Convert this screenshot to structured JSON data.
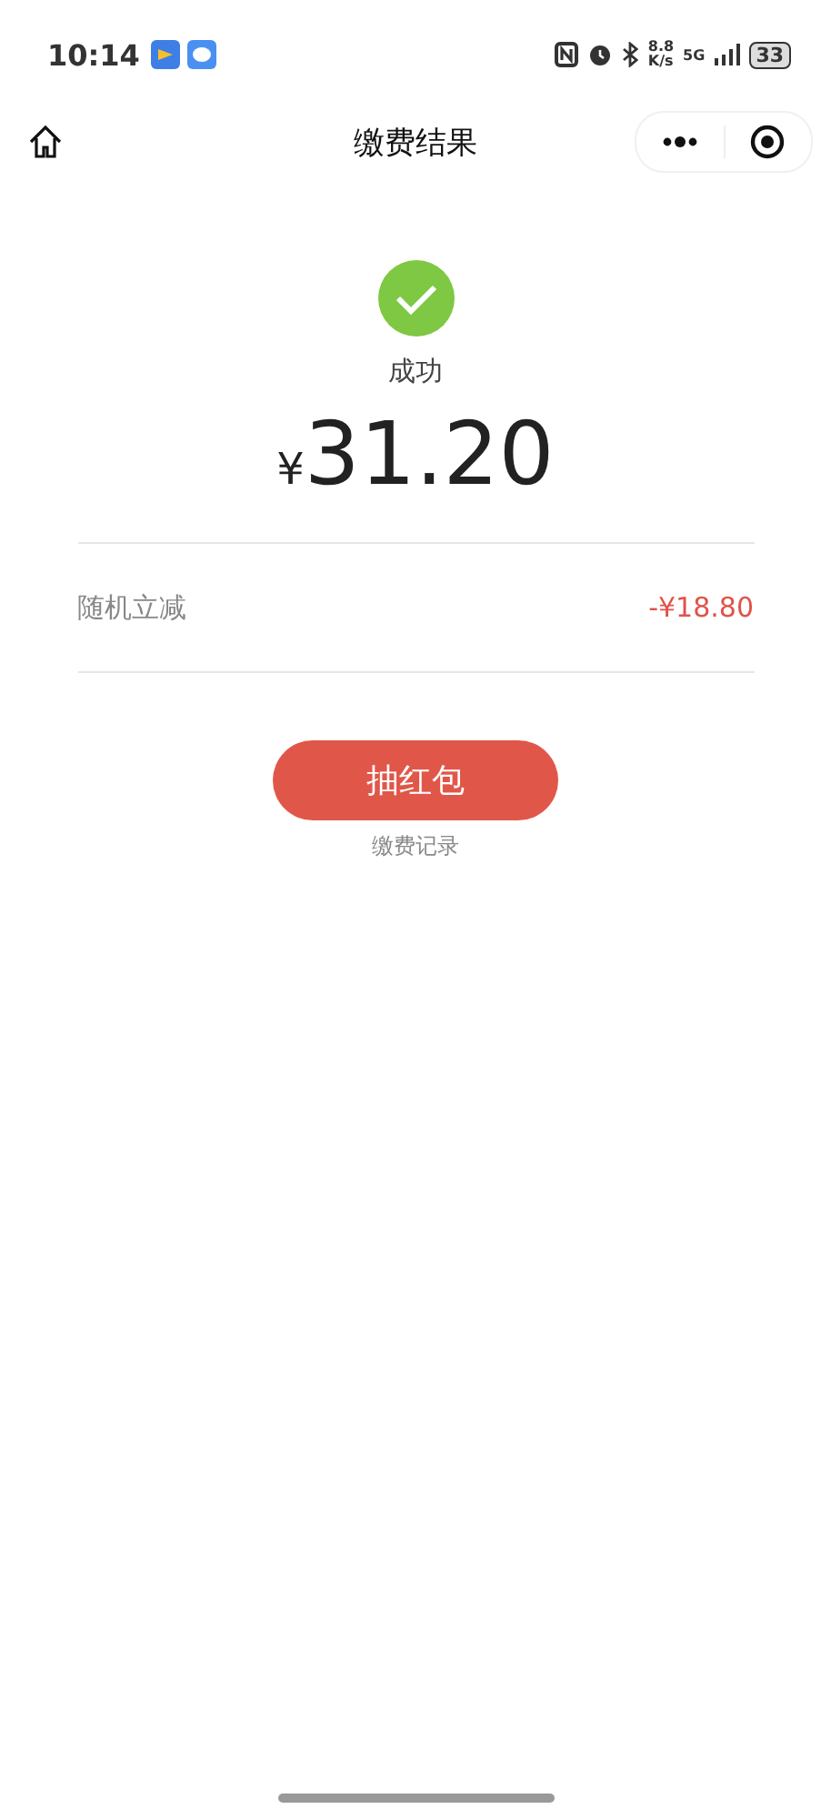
{
  "status_bar": {
    "time": "10:14",
    "net_speed": "8.8",
    "net_unit": "K/s",
    "network": "5G",
    "battery": "33"
  },
  "header": {
    "title": "缴费结果"
  },
  "result": {
    "status": "成功",
    "currency": "¥",
    "amount": "31.20"
  },
  "discount": {
    "label": "随机立减",
    "value": "-¥18.80"
  },
  "action_button": "抽红包",
  "record_link": "缴费记录"
}
